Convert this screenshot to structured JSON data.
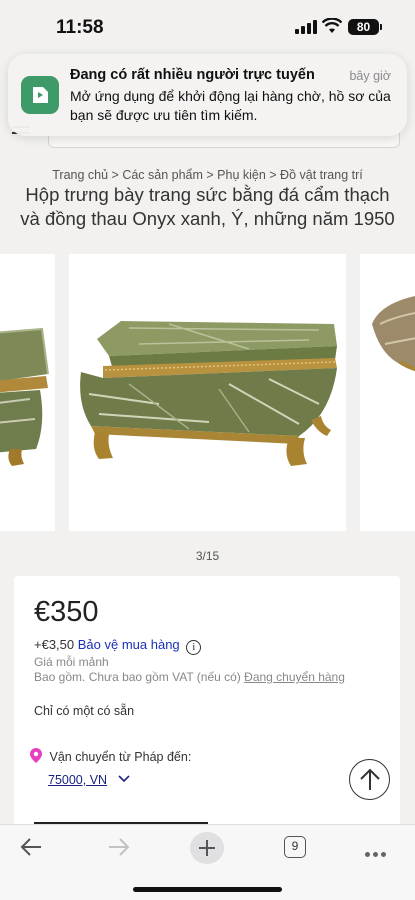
{
  "status_bar": {
    "time": "11:58",
    "battery": "80"
  },
  "notification": {
    "title": "Đang có rất nhiều người trực tuyến",
    "time": "bây giờ",
    "body": "Mở ứng dụng để khởi động lại hàng chờ, hồ sơ của bạn sẽ được ưu tiên tìm kiếm."
  },
  "breadcrumb": "Trang chủ > Các sản phẩm > Phụ kiện > Đồ vật trang trí",
  "product": {
    "title_line1": "Hộp trưng bày trang sức bằng đá cẩm thạch",
    "title_line2": "và đồng thau Onyx xanh, Ý, những năm 1950"
  },
  "gallery": {
    "counter": "3/15"
  },
  "pricing": {
    "price": "€350",
    "protection_fee": "+€3,50",
    "protection_label": "Bảo vệ mua hàng",
    "info_glyph": "i",
    "unit_note": "Giá mỗi mảnh",
    "vat_note": "Bao gồm. Chưa bao gồm VAT (nếu có)",
    "shipping_link": "Đang chuyển hàng",
    "stock": "Chỉ có một có sẵn",
    "ship_from": "Vận chuyển từ Pháp đến:",
    "postal_code": "75000, VN"
  },
  "toolbar": {
    "tab_count": "9"
  },
  "colors": {
    "accent_link": "#1a2fb8",
    "notif_icon": "#3f9a6a",
    "pin": "#e83fbf",
    "page_bg": "#f2f1ef"
  },
  "icons": [
    "back-arrow-icon",
    "forward-arrow-icon",
    "plus-icon",
    "tabs-icon",
    "more-icon",
    "arrow-up-icon",
    "location-pin-icon",
    "chevron-down-icon",
    "info-icon",
    "hamburger-icon"
  ]
}
